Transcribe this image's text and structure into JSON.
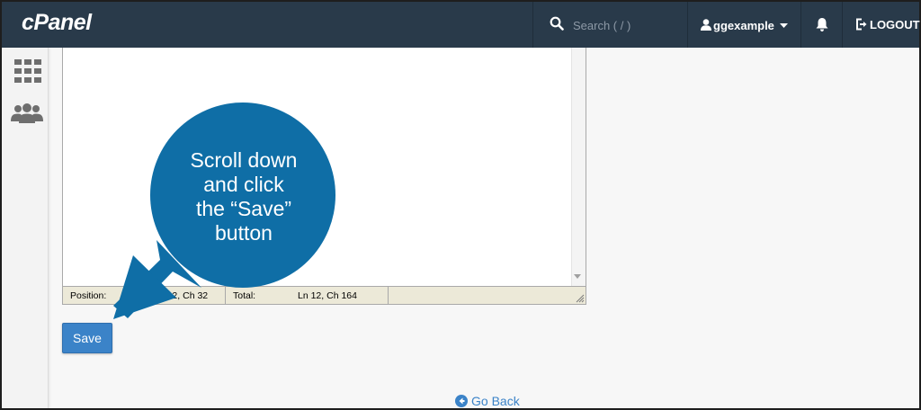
{
  "header": {
    "logo": "cPanel",
    "search_placeholder": "Search ( / )",
    "username": "ggexample",
    "logout_label": "LOGOUT"
  },
  "editor": {
    "status": {
      "position_label": "Position:",
      "position_value": "Ln 12, Ch 32",
      "total_label": "Total:",
      "total_value": "Ln 12, Ch 164"
    }
  },
  "actions": {
    "save_label": "Save",
    "go_back_label": "Go Back"
  },
  "callout": {
    "lines": [
      "Scroll down",
      "and click",
      "the “Save”",
      "button"
    ]
  },
  "colors": {
    "topbar": "#293a4a",
    "accent": "#3b83c8",
    "callout": "#0f6ea6"
  },
  "icons": {
    "search": "search-icon",
    "user": "user-icon",
    "caret": "caret-down-icon",
    "bell": "bell-icon",
    "logout": "logout-icon",
    "grid": "grid-icon",
    "users": "users-icon",
    "back": "arrow-left-circle-icon"
  }
}
